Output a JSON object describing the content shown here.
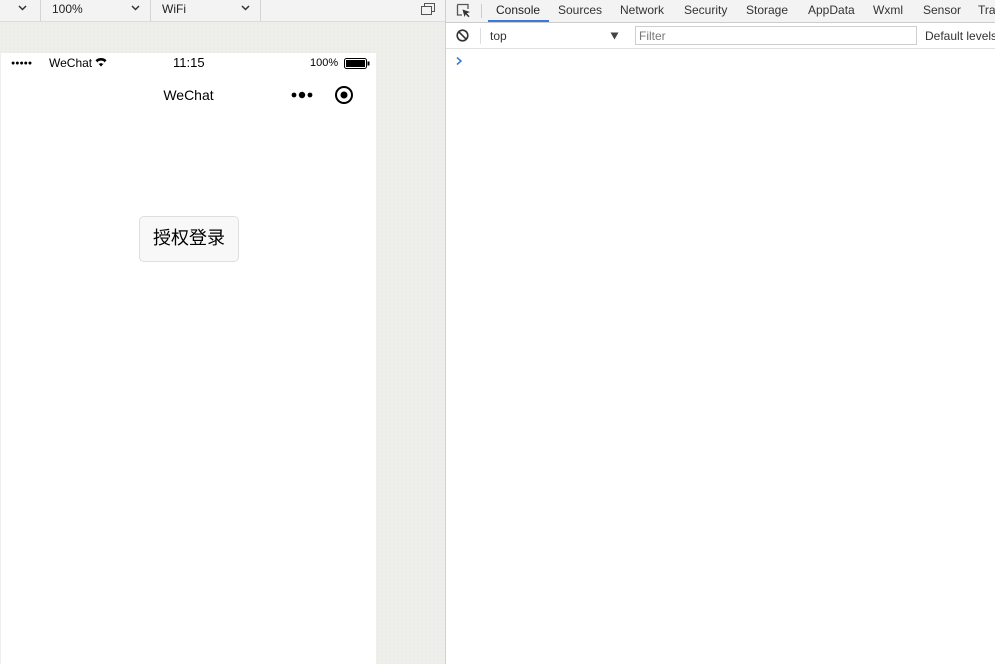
{
  "toolbar": {
    "zoom_value": "100%",
    "network_value": "WiFi"
  },
  "phone": {
    "status_bar": {
      "signal": "●●●●●",
      "carrier": "WeChat",
      "time": "11:15",
      "battery": "100%"
    },
    "nav": {
      "title": "WeChat"
    },
    "auth_button_label": "授权登录"
  },
  "devtools": {
    "tabs": [
      {
        "label": "Console",
        "active": true
      },
      {
        "label": "Sources"
      },
      {
        "label": "Network"
      },
      {
        "label": "Security"
      },
      {
        "label": "Storage"
      },
      {
        "label": "AppData"
      },
      {
        "label": "Wxml"
      },
      {
        "label": "Sensor"
      },
      {
        "label": "Tra"
      }
    ],
    "console": {
      "context": "top",
      "filter_placeholder": "Filter",
      "levels": "Default levels"
    }
  },
  "colors": {
    "accent": "#3879d9",
    "button_bg": "#f8f8f8"
  }
}
